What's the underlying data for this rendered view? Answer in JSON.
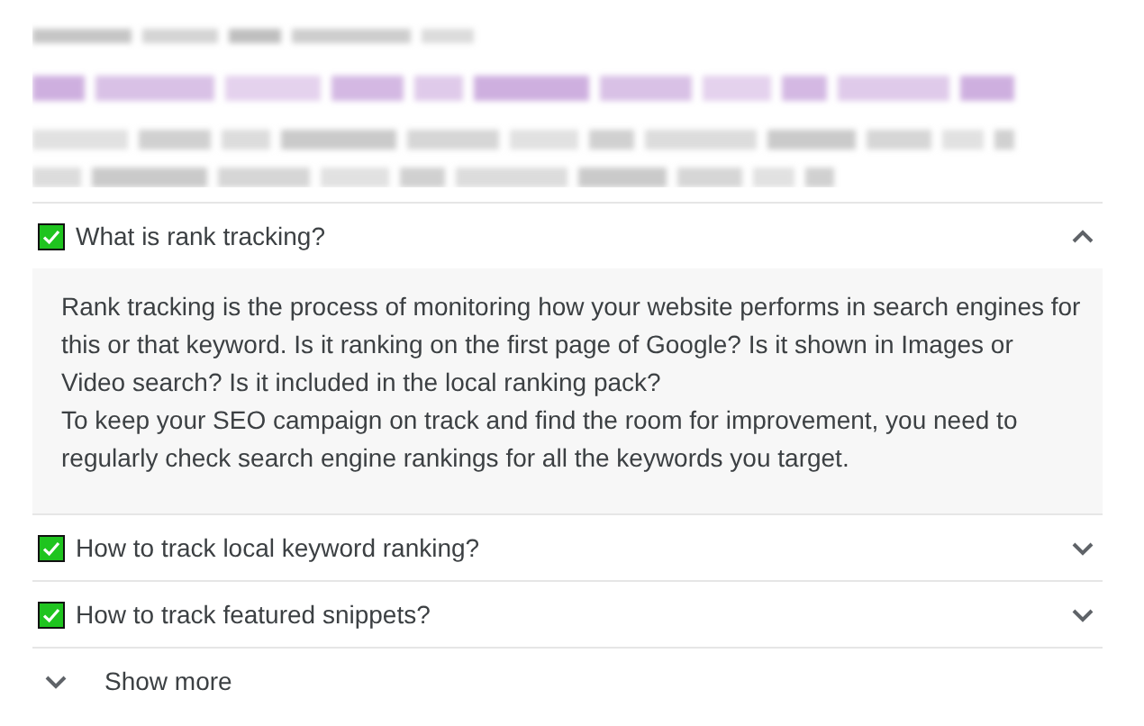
{
  "questions": [
    {
      "question": "What is rank tracking?",
      "expanded": true,
      "answer": [
        "Rank tracking is the process of monitoring how your website performs in search engines for this or that keyword. Is it ranking on the first page of Google? Is it shown in Images or Video search? Is it included in the local ranking pack?",
        "To keep your SEO campaign on track and find the room for improvement, you need to regularly check search engine rankings for all the keywords you target."
      ]
    },
    {
      "question": "How to track local keyword ranking?",
      "expanded": false
    },
    {
      "question": "How to track featured snippets?",
      "expanded": false
    }
  ],
  "show_more": "Show more"
}
